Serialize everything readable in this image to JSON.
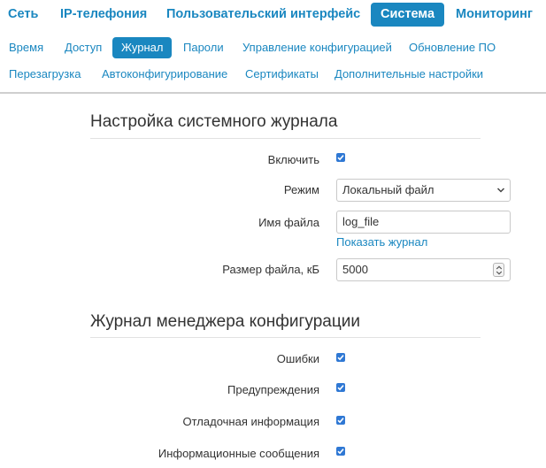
{
  "top_nav": [
    {
      "label": "Сеть",
      "active": false
    },
    {
      "label": "IP-телефония",
      "active": false
    },
    {
      "label": "Пользовательский интерфейс",
      "active": false
    },
    {
      "label": "Система",
      "active": true
    },
    {
      "label": "Мониторинг",
      "active": false
    }
  ],
  "sub_nav": [
    {
      "label": "Время",
      "active": false
    },
    {
      "label": "Доступ",
      "active": false
    },
    {
      "label": "Журнал",
      "active": true
    },
    {
      "label": "Пароли",
      "active": false
    },
    {
      "label": "Управление конфигурацией",
      "active": false
    },
    {
      "label": "Обновление ПО",
      "active": false
    },
    {
      "label": "Перезагрузка",
      "active": false
    },
    {
      "label": "Автоконфигурирование",
      "active": false
    },
    {
      "label": "Сертификаты",
      "active": false
    },
    {
      "label": "Дополнительные настройки",
      "active": false
    }
  ],
  "syslog": {
    "title": "Настройка системного журнала",
    "enable_label": "Включить",
    "enable_checked": true,
    "mode_label": "Режим",
    "mode_value": "Локальный файл",
    "filename_label": "Имя файла",
    "filename_value": "log_file",
    "show_log_link": "Показать журнал",
    "filesize_label": "Размер файла, кБ",
    "filesize_value": "5000"
  },
  "config_log": {
    "title": "Журнал менеджера конфигурации",
    "items": [
      {
        "label": "Ошибки",
        "checked": true
      },
      {
        "label": "Предупреждения",
        "checked": true
      },
      {
        "label": "Отладочная информация",
        "checked": true
      },
      {
        "label": "Информационные сообщения",
        "checked": true
      }
    ]
  },
  "colors": {
    "accent": "#1a87c0",
    "checkbox": "#2f78d4"
  },
  "icons": {
    "checkbox_check": "checkmark-icon",
    "select_arrow": "chevron-down-icon",
    "number_spinner": "spinner-arrows-icon"
  }
}
